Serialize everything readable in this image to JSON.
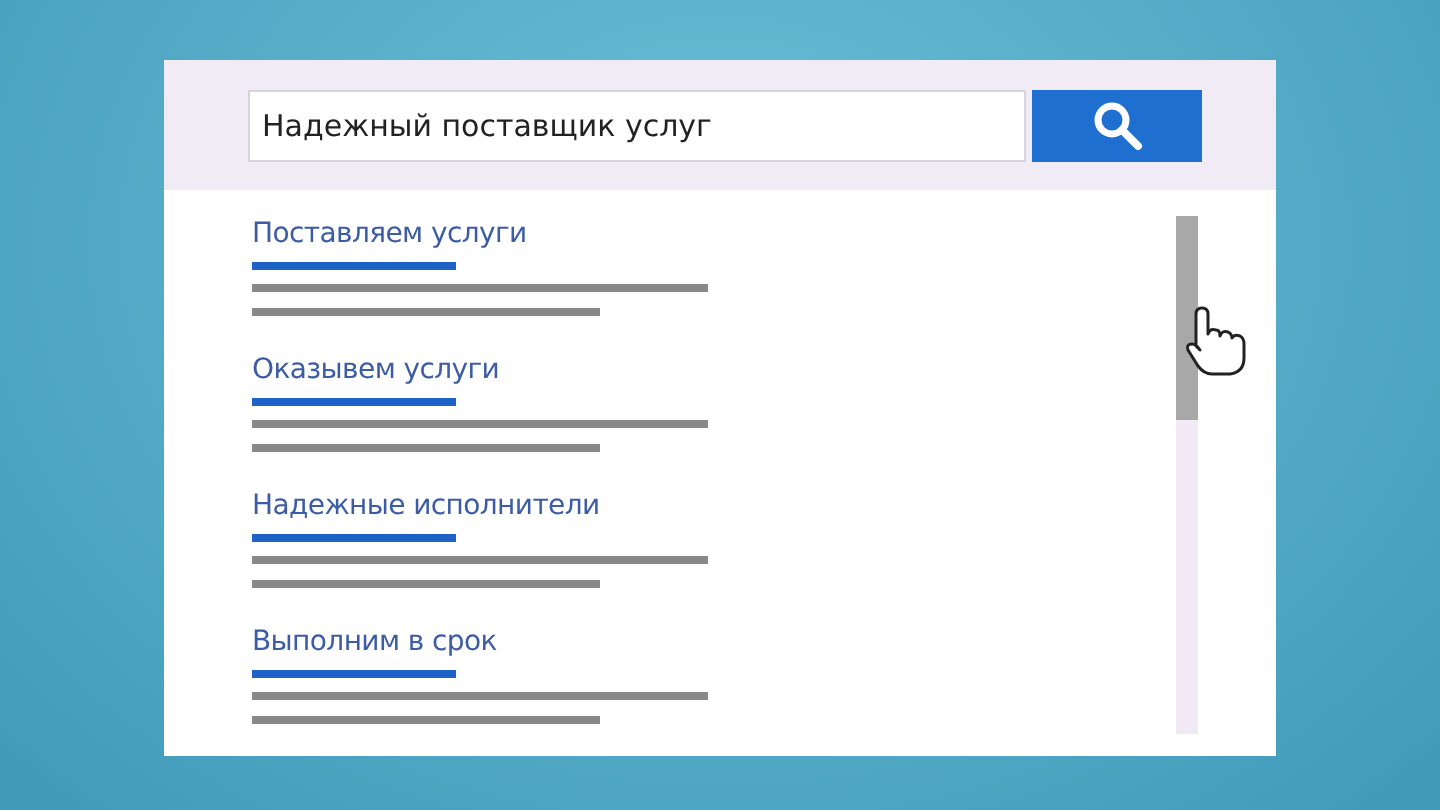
{
  "search": {
    "value": "Надежный поставщик услуг"
  },
  "results": [
    {
      "title": "Поставляем услуги"
    },
    {
      "title": "Оказывем услуги"
    },
    {
      "title": "Надежные исполнители"
    },
    {
      "title": "Выполним в срок"
    }
  ]
}
